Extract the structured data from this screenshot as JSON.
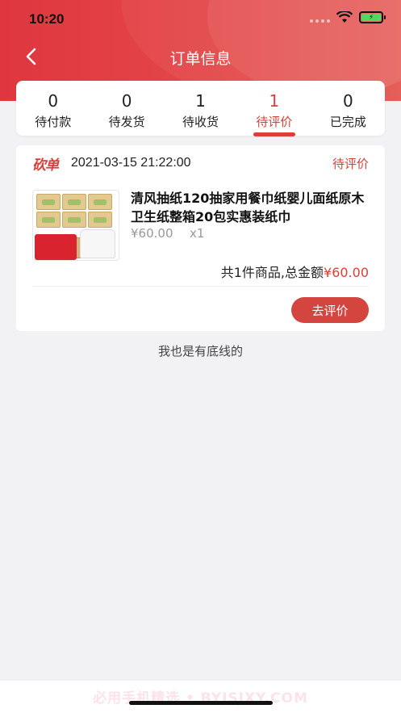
{
  "status_bar": {
    "time": "10:20"
  },
  "nav": {
    "title": "订单信息",
    "back_icon": "chevron-left-icon"
  },
  "tabs": [
    {
      "count": "0",
      "label": "待付款",
      "active": false
    },
    {
      "count": "0",
      "label": "待发货",
      "active": false
    },
    {
      "count": "1",
      "label": "待收货",
      "active": false
    },
    {
      "count": "1",
      "label": "待评价",
      "active": true
    },
    {
      "count": "0",
      "label": "已完成",
      "active": false
    }
  ],
  "order": {
    "shop_logo": "砍单",
    "datetime": "2021-03-15 21:22:00",
    "status": "待评价",
    "product": {
      "name": "清风抽纸120抽家用餐巾纸婴儿面纸原木卫生纸整箱20包实惠装纸巾",
      "price": "¥60.00",
      "quantity": "x1"
    },
    "summary_prefix": "共1件商品,总金额",
    "summary_amount": "¥60.00",
    "action_label": "去评价"
  },
  "footer": {
    "end_text": "我也是有底线的"
  },
  "watermark": "必用手机精选 • BYJSJXY.COM",
  "colors": {
    "brand": "#d9403a",
    "header": "#e0363f"
  }
}
